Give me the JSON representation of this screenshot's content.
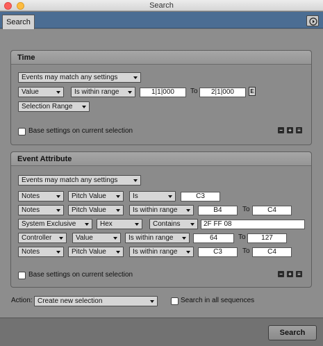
{
  "window": {
    "title": "Search"
  },
  "tabs": {
    "search": "Search"
  },
  "time": {
    "title": "Time",
    "match_mode": "Events may match any settings",
    "field": "Value",
    "operator": "Is within range",
    "from": "1|1|000",
    "to_label": "To",
    "to": "2|1|000",
    "e_button": "E",
    "range_source": "Selection Range",
    "base_on_selection": "Base settings on current selection"
  },
  "event_attribute": {
    "title": "Event Attribute",
    "match_mode": "Events may match any settings",
    "rows": [
      {
        "type": "Notes",
        "attr": "Pitch Value",
        "op": "Is",
        "v1": "C3"
      },
      {
        "type": "Notes",
        "attr": "Pitch Value",
        "op": "Is within range",
        "v1": "B4",
        "to": "To",
        "v2": "C4"
      },
      {
        "type": "System Exclusive",
        "attr": "Hex",
        "op": "Contains",
        "v1": "2F FF 08"
      },
      {
        "type": "Controller",
        "attr": "Value",
        "op": "Is within range",
        "v1": "64",
        "to": "To",
        "v2": "127"
      },
      {
        "type": "Notes",
        "attr": "Pitch Value",
        "op": "Is within range",
        "v1": "C3",
        "to": "To",
        "v2": "C4"
      }
    ],
    "base_on_selection": "Base settings on current selection"
  },
  "controls": {
    "minus": "−",
    "plus": "+",
    "menu": "≡"
  },
  "action": {
    "label": "Action:",
    "value": "Create new selection",
    "search_all": "Search in all sequences"
  },
  "footer": {
    "search_button": "Search"
  }
}
